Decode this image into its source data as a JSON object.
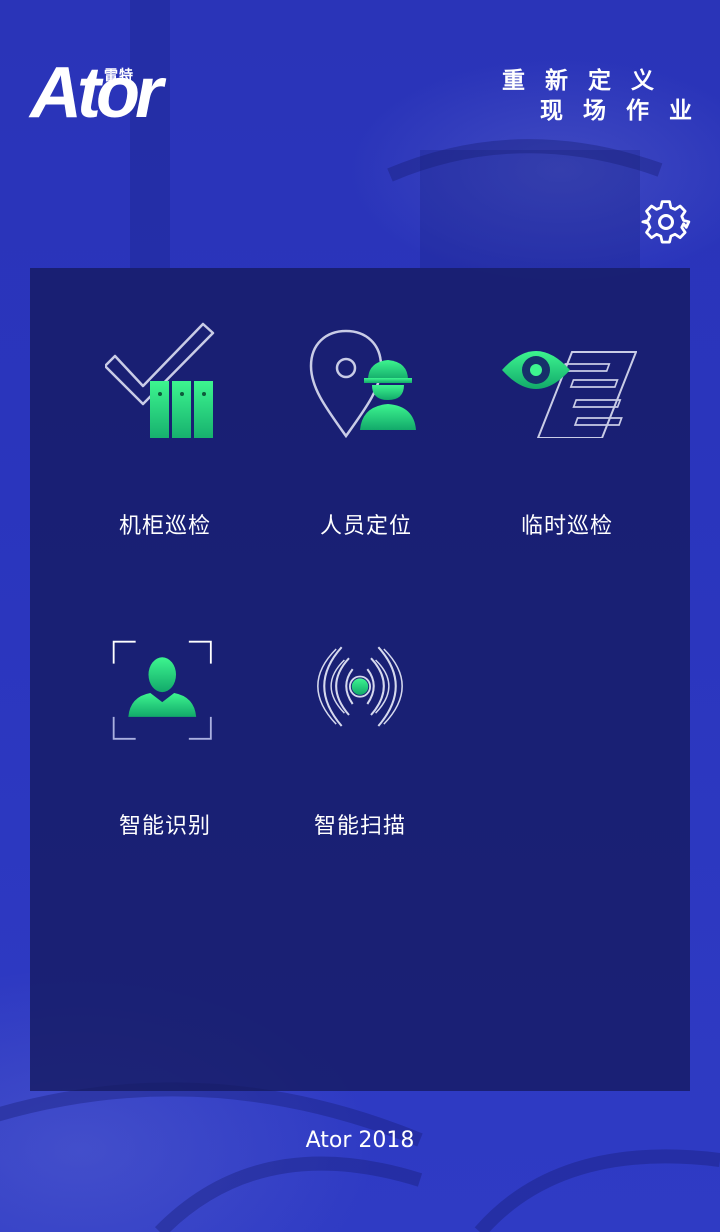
{
  "header": {
    "logo_text": "Ator",
    "logo_cn": "雷特",
    "slogan_line1": "重新定义",
    "slogan_line2": "现场作业"
  },
  "settings_icon": "gear-icon",
  "menu": [
    {
      "label": "机柜巡检",
      "icon": "cabinet-check-icon"
    },
    {
      "label": "人员定位",
      "icon": "person-location-icon"
    },
    {
      "label": "临时巡检",
      "icon": "eye-checklist-icon"
    },
    {
      "label": "智能识别",
      "icon": "face-scan-icon"
    },
    {
      "label": "智能扫描",
      "icon": "signal-scan-icon"
    }
  ],
  "footer": {
    "text": "Ator 2018"
  },
  "colors": {
    "background": "#2b36bd",
    "panel": "#151b60",
    "accent_green_top": "#3df58f",
    "accent_green_bottom": "#12a96a"
  }
}
